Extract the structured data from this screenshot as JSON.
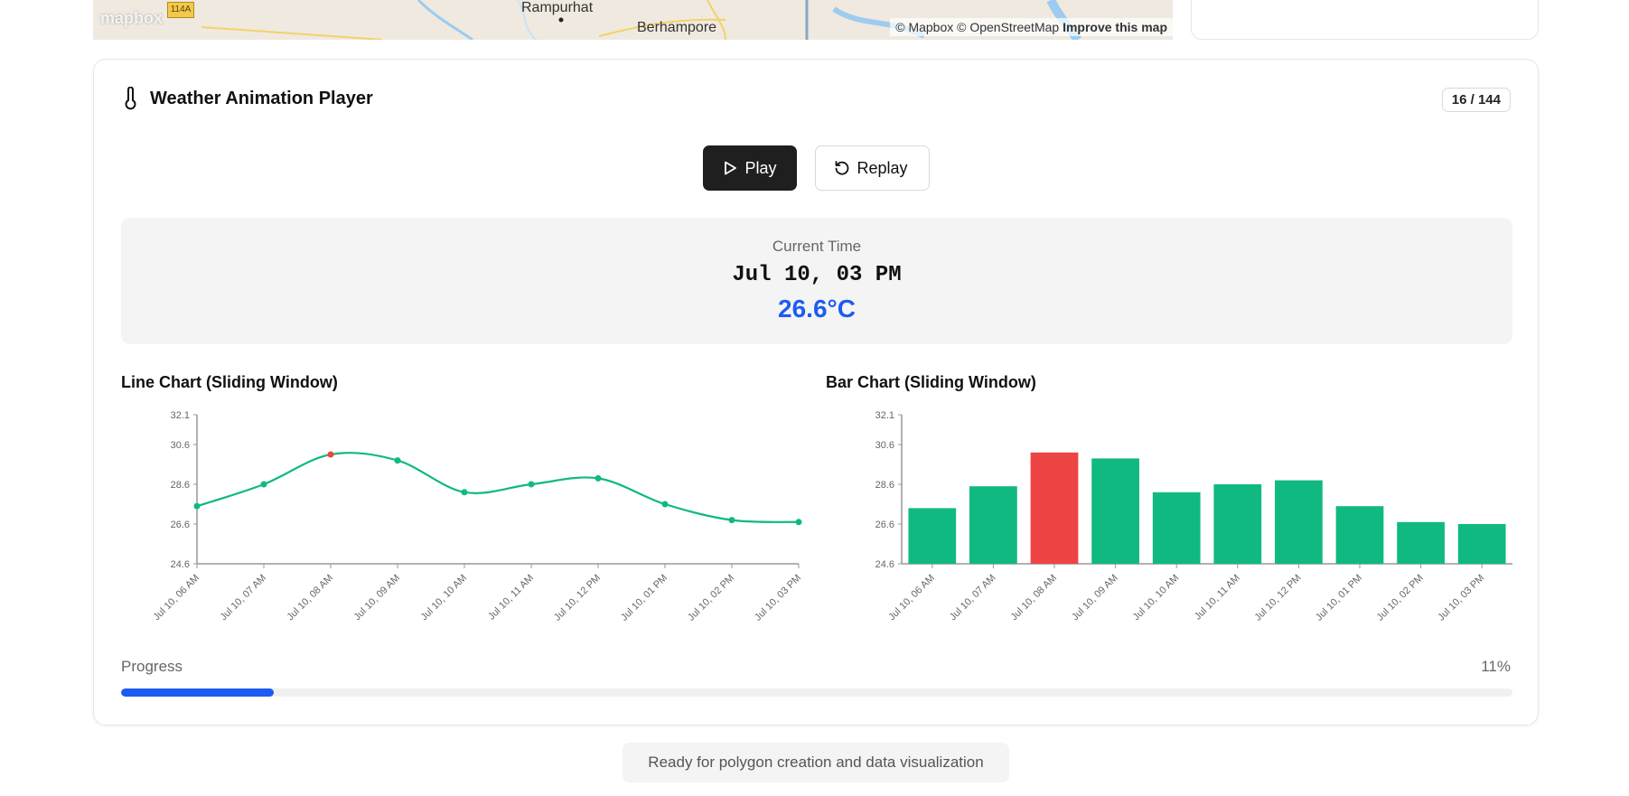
{
  "map": {
    "logo": "mapbox",
    "shield": "114A",
    "places": [
      "Rampurhat",
      "Berhampore"
    ],
    "attribution": "© Mapbox © OpenStreetMap",
    "improve_link": "Improve this map"
  },
  "player": {
    "title": "Weather Animation Player",
    "frame_badge": "16 / 144",
    "play_label": "Play",
    "replay_label": "Replay",
    "current_time_label": "Current Time",
    "current_time": "Jul 10, 03 PM",
    "current_temp": "26.6°C",
    "progress_label": "Progress",
    "progress_pct": "11%",
    "progress_fraction": 0.11
  },
  "status": "Ready for polygon creation and data visualization",
  "colors": {
    "accent_blue": "#1d5cf2",
    "series_green": "#10b981",
    "highlight_red": "#ef4444",
    "button_dark": "#1f1f1f"
  },
  "chart_data": [
    {
      "type": "line",
      "title": "Line Chart (Sliding Window)",
      "categories": [
        "Jul 10, 06 AM",
        "Jul 10, 07 AM",
        "Jul 10, 08 AM",
        "Jul 10, 09 AM",
        "Jul 10, 10 AM",
        "Jul 10, 11 AM",
        "Jul 10, 12 PM",
        "Jul 10, 01 PM",
        "Jul 10, 02 PM",
        "Jul 10, 03 PM"
      ],
      "values": [
        27.5,
        28.6,
        30.1,
        29.8,
        28.2,
        28.6,
        28.9,
        27.6,
        26.8,
        26.7
      ],
      "highlight_index": 2,
      "yticks": [
        24.6,
        26.6,
        28.6,
        30.6,
        32.1
      ],
      "ylim": [
        24.6,
        32.1
      ],
      "grid": false
    },
    {
      "type": "bar",
      "title": "Bar Chart (Sliding Window)",
      "categories": [
        "Jul 10, 06 AM",
        "Jul 10, 07 AM",
        "Jul 10, 08 AM",
        "Jul 10, 09 AM",
        "Jul 10, 10 AM",
        "Jul 10, 11 AM",
        "Jul 10, 12 PM",
        "Jul 10, 01 PM",
        "Jul 10, 02 PM",
        "Jul 10, 03 PM"
      ],
      "values": [
        27.4,
        28.5,
        30.2,
        29.9,
        28.2,
        28.6,
        28.8,
        27.5,
        26.7,
        26.6
      ],
      "highlight_index": 2,
      "yticks": [
        24.6,
        26.6,
        28.6,
        30.6,
        32.1
      ],
      "ylim": [
        24.6,
        32.1
      ],
      "grid": false
    }
  ]
}
